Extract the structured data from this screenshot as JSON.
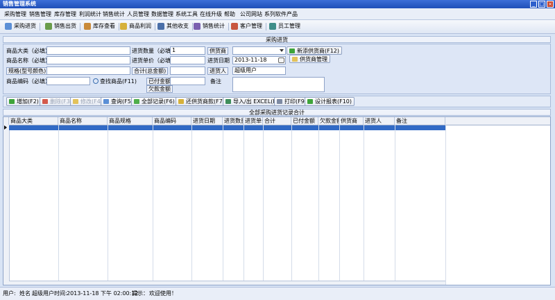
{
  "window": {
    "title": "销售管理系统"
  },
  "menu": [
    "采购管理",
    "销售管理",
    "库存管理",
    "利润统计",
    "销售统计",
    "人员管理",
    "数据管理",
    "系统工具",
    "在线升级",
    "帮助",
    "公司网站",
    "系列软件产品"
  ],
  "toolbar": [
    "采购进货",
    "销售出货",
    "库存查看",
    "商品利润",
    "其他收支",
    "销售统计",
    "客户管理",
    "员工管理"
  ],
  "colors": {
    "accent": "#316ac5",
    "titlebar": "#1f4fb8"
  },
  "form": {
    "section_title": "采购进货",
    "product_category_label": "商品大类（必填）",
    "product_name_label": "商品名称（必填）",
    "spec_label": "规格(型号颜色)",
    "product_code_label": "商品编码（必填）",
    "find_product_label": "查找商品(F11)",
    "quantity_label": "进货数量（必填）",
    "quantity_value": "1",
    "unit_price_label": "进货单价（必填）",
    "total_label": "合计(总金额)",
    "paid_label": "已付金额",
    "owed_label": "欠款金额",
    "supplier_label": "供货商",
    "date_label": "进货日期",
    "date_value": "2013-11-18",
    "purchaser_label": "进货人",
    "purchaser_value": "超级用户",
    "remarks_label": "备注",
    "add_supplier_label": "新添供货商(F12)",
    "supplier_mgmt_label": "供货商管理"
  },
  "actions": [
    "增加(F2)",
    "删除(F3)",
    "修改(F4)",
    "查询(F5)",
    "全部记录(F6)",
    "还供货商款(F7)",
    "导入/出 EXCEL(F8)",
    "打印(F9)",
    "设计报表(F10)"
  ],
  "table": {
    "title": "全部采购进货记录合计",
    "columns": [
      "商品大类",
      "商品名称",
      "商品规格",
      "商品编码",
      "进货日期",
      "进货数量",
      "进货单价",
      "合计",
      "已付金额",
      "欠款金额",
      "供货商",
      "进货人",
      "备注"
    ]
  },
  "status": {
    "user_label": "用户:",
    "name_label": "姓名",
    "name_value": "超级用户",
    "time_label": "时间:",
    "time_value": "2013-11-18 下午 02:00:12",
    "hint_label": "提示：",
    "hint_value": "欢迎使用！"
  }
}
